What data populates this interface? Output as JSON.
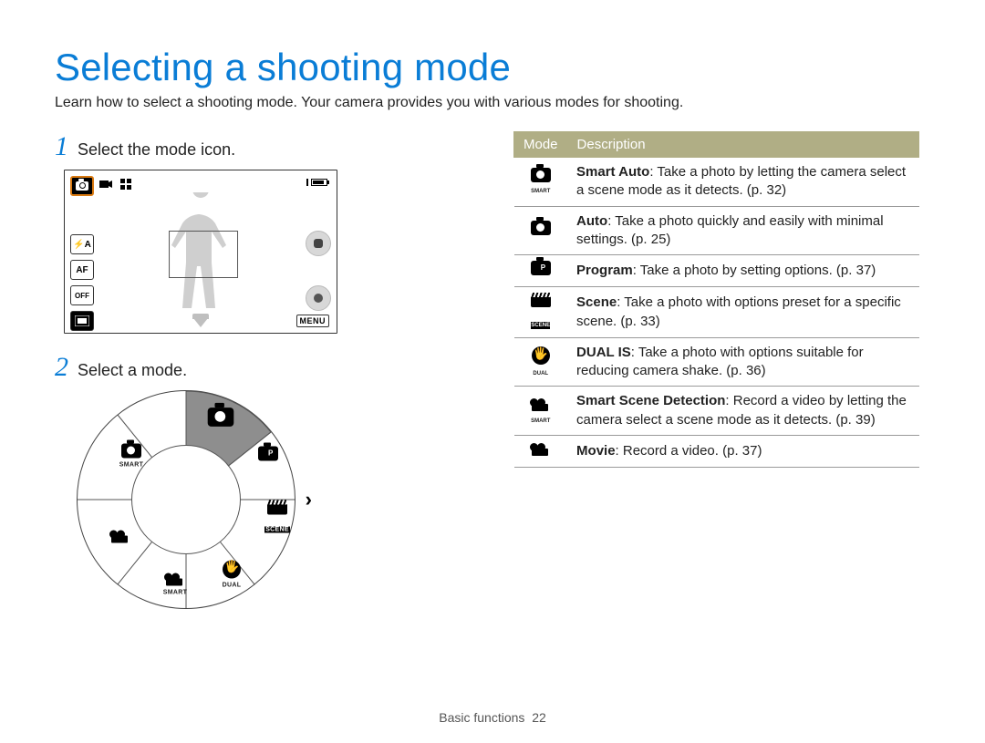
{
  "title": "Selecting a shooting mode",
  "intro": "Learn how to select a shooting mode. Your camera provides you with various modes for shooting.",
  "steps": {
    "n1": "1",
    "s1": "Select the mode icon.",
    "n2": "2",
    "s2": "Select a mode."
  },
  "screen": {
    "menu_label": "MENU",
    "side_labels": {
      "flash": "⚡A",
      "af": "AF",
      "off": "OFF"
    }
  },
  "dial": {
    "items": [
      {
        "name": "auto",
        "label": ""
      },
      {
        "name": "program",
        "label": ""
      },
      {
        "name": "scene",
        "label": "SCENE"
      },
      {
        "name": "dual-is",
        "label": "DUAL"
      },
      {
        "name": "smart-scene-video",
        "label": "SMART"
      },
      {
        "name": "movie",
        "label": ""
      },
      {
        "name": "smart-auto",
        "label": "SMART"
      }
    ]
  },
  "table": {
    "header": {
      "mode": "Mode",
      "desc": "Description"
    },
    "rows": [
      {
        "icon": "smart-auto",
        "title": "Smart Auto",
        "text": ": Take a photo by letting the camera select a scene mode as it detects. (p. 32)"
      },
      {
        "icon": "auto",
        "title": "Auto",
        "text": ": Take a photo quickly and easily with minimal settings. (p. 25)"
      },
      {
        "icon": "program",
        "title": "Program",
        "text": ": Take a photo by setting options. (p. 37)"
      },
      {
        "icon": "scene",
        "title": "Scene",
        "text": ": Take a photo with options preset for a specific scene. (p. 33)"
      },
      {
        "icon": "dual-is",
        "title": "DUAL IS",
        "text": ": Take a photo with options suitable for reducing camera shake. (p. 36)"
      },
      {
        "icon": "smart-scene",
        "title": "Smart Scene Detection",
        "text": ": Record a video by letting the camera select a scene mode as it detects. (p. 39)"
      },
      {
        "icon": "movie",
        "title": "Movie",
        "text": ": Record a video. (p. 37)"
      }
    ]
  },
  "footer": {
    "section": "Basic functions",
    "page": "22"
  }
}
